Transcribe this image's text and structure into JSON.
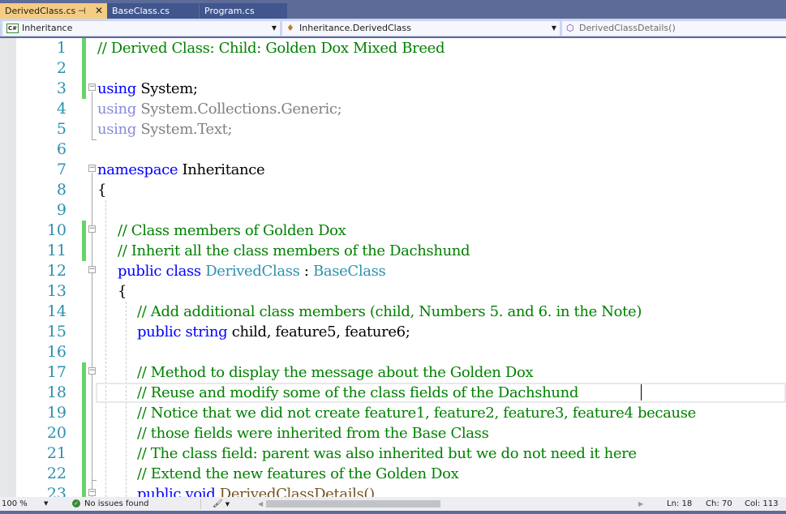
{
  "tabs": [
    {
      "label": "DerivedClass.cs",
      "active": true,
      "pin_icon": "pin-icon",
      "close_icon": "close-icon"
    },
    {
      "label": "BaseClass.cs",
      "active": false
    },
    {
      "label": "Program.cs",
      "active": false
    }
  ],
  "navbar": {
    "project": {
      "label": "Inheritance",
      "icon": "csharp-project-icon"
    },
    "type": {
      "label": "Inheritance.DerivedClass",
      "icon": "class-icon"
    },
    "member": {
      "label": "DerivedClassDetails()",
      "icon": "method-icon"
    }
  },
  "editor": {
    "lines": [
      {
        "n": "1",
        "text": "// Derived Class: Child: Golden Dox Mixed Breed"
      },
      {
        "n": "2",
        "text": ""
      },
      {
        "n": "3",
        "kw": "using",
        "rest": " System;"
      },
      {
        "n": "4",
        "kw": "using",
        "rest": " System.Collections.Generic;"
      },
      {
        "n": "5",
        "kw": "using",
        "rest": " System.Text;"
      },
      {
        "n": "6",
        "text": ""
      },
      {
        "n": "7",
        "kw": "namespace",
        "rest": " Inheritance"
      },
      {
        "n": "8",
        "text": "{"
      },
      {
        "n": "9",
        "text": ""
      },
      {
        "n": "10",
        "text": "// Class members of Golden Dox"
      },
      {
        "n": "11",
        "text": "// Inherit all the class members of the Dachshund"
      },
      {
        "n": "12",
        "kw": "public class",
        "type1": "DerivedClass",
        "sep": " : ",
        "type2": "BaseClass"
      },
      {
        "n": "13",
        "text": "{"
      },
      {
        "n": "14",
        "text": "// Add additional class members (child, Numbers 5. and 6. in the Note)"
      },
      {
        "n": "15",
        "kw": "public string",
        "rest": " child, feature5, feature6;"
      },
      {
        "n": "16",
        "text": ""
      },
      {
        "n": "17",
        "text": "// Method to display the message about the Golden Dox"
      },
      {
        "n": "18",
        "text": "// Reuse and modify some of the class fields of the Dachshund"
      },
      {
        "n": "19",
        "text": "// Notice that we did not create feature1, feature2, feature3, feature4 because"
      },
      {
        "n": "20",
        "text": "// those fields were inherited from the Base Class"
      },
      {
        "n": "21",
        "text": "// The class field: parent was also inherited but we do not need it here"
      },
      {
        "n": "22",
        "text": "// Extend the new features of the Golden Dox"
      },
      {
        "n": "23",
        "kw": "public void",
        "rest": " DerivedClassDetails()"
      }
    ]
  },
  "statusbar": {
    "zoom": "100 %",
    "issues": "No issues found",
    "ln": "Ln: 18",
    "ch": "Ch: 70",
    "col": "Col: 113"
  }
}
